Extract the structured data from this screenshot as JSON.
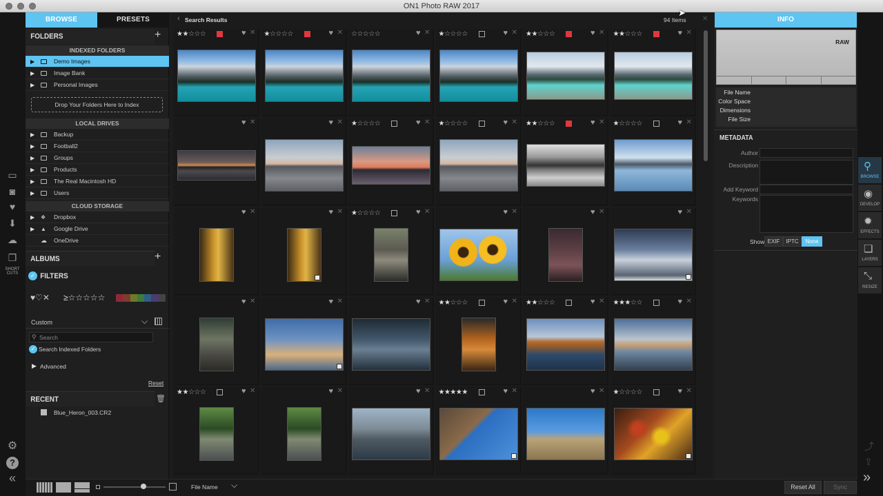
{
  "window": {
    "title": "ON1 Photo RAW 2017"
  },
  "left_tabs": {
    "browse": "BROWSE",
    "presets": "PRESETS"
  },
  "folders": {
    "title": "FOLDERS",
    "add": "+",
    "indexed_title": "INDEXED FOLDERS",
    "indexed": [
      "Demo Images",
      "Image Bank",
      "Personal Images"
    ],
    "drop_button": "Drop Your Folders Here to Index",
    "local_title": "LOCAL DRIVES",
    "local": [
      "Backup",
      "Football2",
      "Groups",
      "Products",
      "The Real Macintosh HD",
      "Users"
    ],
    "cloud_title": "CLOUD STORAGE",
    "cloud": [
      "Dropbox",
      "Google Drive",
      "OneDrive"
    ]
  },
  "albums": {
    "title": "ALBUMS",
    "add": "+"
  },
  "filters": {
    "title": "FILTERS",
    "rating_filter": "≥☆☆☆☆☆",
    "preset": "Custom",
    "search_placeholder": "Search",
    "search_indexed": "Search Indexed Folders",
    "advanced": "Advanced",
    "reset": "Reset",
    "swatches": [
      "#8b2a36",
      "#7f3b2e",
      "#6b7a2a",
      "#3d7a3e",
      "#2f5e86",
      "#4b3c70",
      "#444"
    ]
  },
  "recent": {
    "title": "RECENT",
    "items": [
      "Blue_Heron_003.CR2"
    ]
  },
  "grid": {
    "header": "Search Results",
    "count": "94 Items",
    "rows": [
      [
        {
          "r": 2,
          "f": "red"
        },
        {
          "r": 1,
          "f": "red"
        },
        {
          "r": 0,
          "f": "none"
        },
        {
          "r": 1,
          "f": "empty"
        },
        {
          "r": 2,
          "f": "red"
        },
        {
          "r": 2,
          "f": "red"
        }
      ],
      [
        {
          "r": -1,
          "f": "none"
        },
        {
          "r": -1,
          "f": "none"
        },
        {
          "r": 1,
          "f": "empty"
        },
        {
          "r": 1,
          "f": "empty"
        },
        {
          "r": 2,
          "f": "red"
        },
        {
          "r": 1,
          "f": "empty"
        }
      ],
      [
        {
          "r": -1,
          "f": "none"
        },
        {
          "r": -1,
          "f": "none"
        },
        {
          "r": 1,
          "f": "empty"
        },
        {
          "r": -1,
          "f": "none"
        },
        {
          "r": -1,
          "f": "none"
        },
        {
          "r": -1,
          "f": "none"
        }
      ],
      [
        {
          "r": -1,
          "f": "none"
        },
        {
          "r": -1,
          "f": "none"
        },
        {
          "r": -1,
          "f": "none"
        },
        {
          "r": 2,
          "f": "empty"
        },
        {
          "r": 2,
          "f": "empty"
        },
        {
          "r": 3,
          "f": "empty"
        }
      ],
      [
        {
          "r": 2,
          "f": "empty"
        },
        {
          "r": -1,
          "f": "none"
        },
        {
          "r": -1,
          "f": "none"
        },
        {
          "r": 5,
          "f": "empty"
        },
        {
          "r": -1,
          "f": "none"
        },
        {
          "r": 1,
          "f": "empty"
        }
      ]
    ],
    "thumbs": [
      [
        "mountain-lake",
        "mountain-lake",
        "mountain-lake",
        "mountain-lake",
        "glacier-lake",
        "glacier-lake"
      ],
      [
        "sunset-water",
        "dusk-water",
        "pink-sunset",
        "dusk-water",
        "bw-lake",
        "blue-lake"
      ],
      [
        "autumn-road",
        "autumn-road",
        "leaf-stone",
        "sunflowers",
        "grass-dusk",
        "cloudy-sky"
      ],
      [
        "hiker-rocks",
        "evening-clouds",
        "storm-clouds",
        "guitar",
        "autumn-reflection",
        "calm-reflection"
      ],
      [
        "bike-path",
        "bike-path",
        "stone-bridge",
        "building-sky",
        "rock-tree",
        "autumn-leaves"
      ]
    ]
  },
  "info": {
    "tab": "INFO",
    "raw": "RAW",
    "fields": [
      "File Name",
      "Color Space",
      "Dimensions",
      "File Size"
    ]
  },
  "metadata": {
    "title": "METADATA",
    "fields": [
      "Author",
      "Description",
      "Add Keyword",
      "Keywords"
    ],
    "show_label": "Show",
    "show_options": [
      "EXIF",
      "IPTC",
      "None"
    ],
    "show_selected": "None"
  },
  "right_tools": [
    "BROWSE",
    "DEVELOP",
    "EFFECTS",
    "LAYERS",
    "RESIZE"
  ],
  "bottom": {
    "sort": "File Name",
    "reset_all": "Reset All",
    "sync": "Sync"
  },
  "left_tools": {
    "shortcuts": "SHORT CUTS"
  },
  "colors": {
    "accent": "#5ec4f2",
    "flag_red": "#e0383e"
  }
}
